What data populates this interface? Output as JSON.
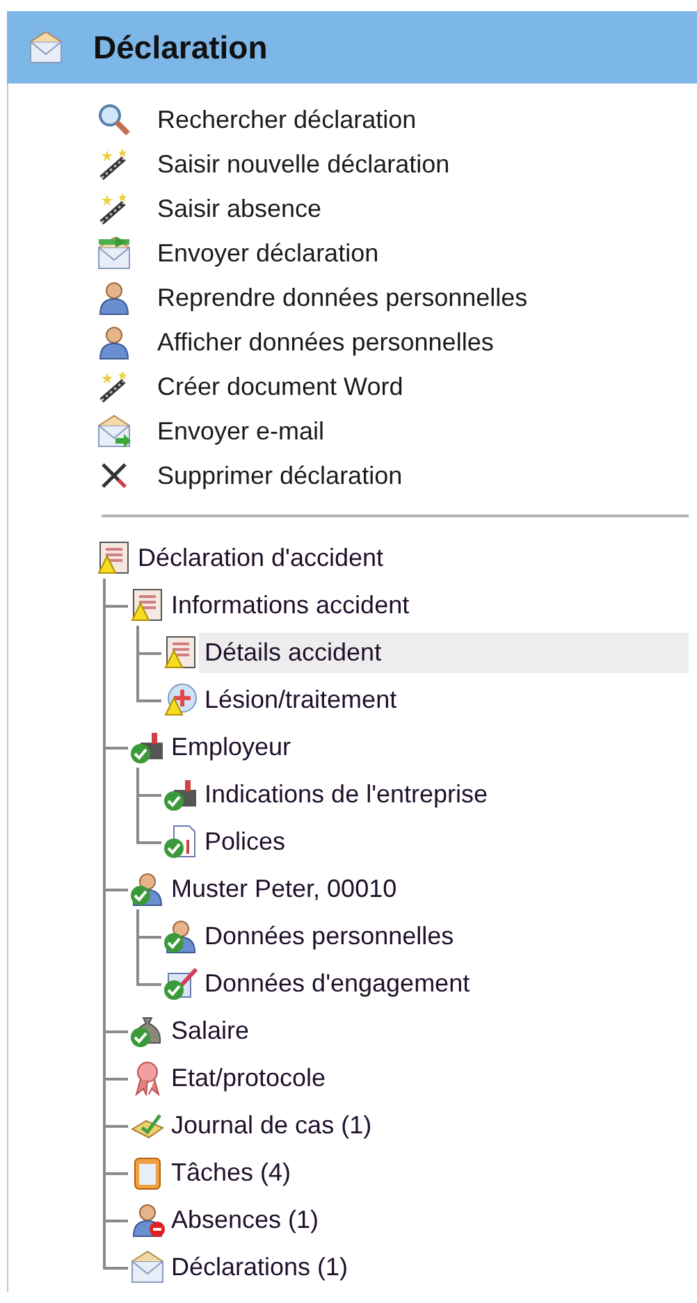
{
  "panel": {
    "title": "Déclaration"
  },
  "actions": [
    {
      "label": "Rechercher déclaration"
    },
    {
      "label": "Saisir nouvelle déclaration"
    },
    {
      "label": "Saisir absence"
    },
    {
      "label": "Envoyer déclaration"
    },
    {
      "label": "Reprendre données personnelles"
    },
    {
      "label": "Afficher données personnelles"
    },
    {
      "label": "Créer document Word"
    },
    {
      "label": "Envoyer e-mail"
    },
    {
      "label": "Supprimer déclaration"
    }
  ],
  "tree": [
    {
      "label": "Déclaration d'accident",
      "kind": "warning",
      "selected": false,
      "children": [
        {
          "label": "Informations accident",
          "kind": "warning",
          "selected": false,
          "children": [
            {
              "label": "Détails accident",
              "kind": "warning",
              "selected": true
            },
            {
              "label": "Lésion/traitement",
              "kind": "warning",
              "selected": false
            }
          ]
        },
        {
          "label": "Employeur",
          "kind": "ok",
          "selected": false,
          "children": [
            {
              "label": "Indications de l'entreprise",
              "kind": "ok",
              "selected": false
            },
            {
              "label": "Polices",
              "kind": "ok",
              "selected": false
            }
          ]
        },
        {
          "label": "Muster Peter, 00010",
          "kind": "ok",
          "selected": false,
          "children": [
            {
              "label": "Données personnelles",
              "kind": "ok",
              "selected": false
            },
            {
              "label": "Données d'engagement",
              "kind": "ok",
              "selected": false
            }
          ]
        },
        {
          "label": "Salaire",
          "kind": "ok",
          "selected": false
        },
        {
          "label": "Etat/protocole",
          "kind": "plain",
          "selected": false
        },
        {
          "label": "Journal de cas (1)",
          "kind": "plain",
          "selected": false
        },
        {
          "label": "Tâches (4)",
          "kind": "plain",
          "selected": false
        },
        {
          "label": "Absences (1)",
          "kind": "plain",
          "selected": false
        },
        {
          "label": "Déclarations (1)",
          "kind": "plain",
          "selected": false
        }
      ]
    }
  ]
}
